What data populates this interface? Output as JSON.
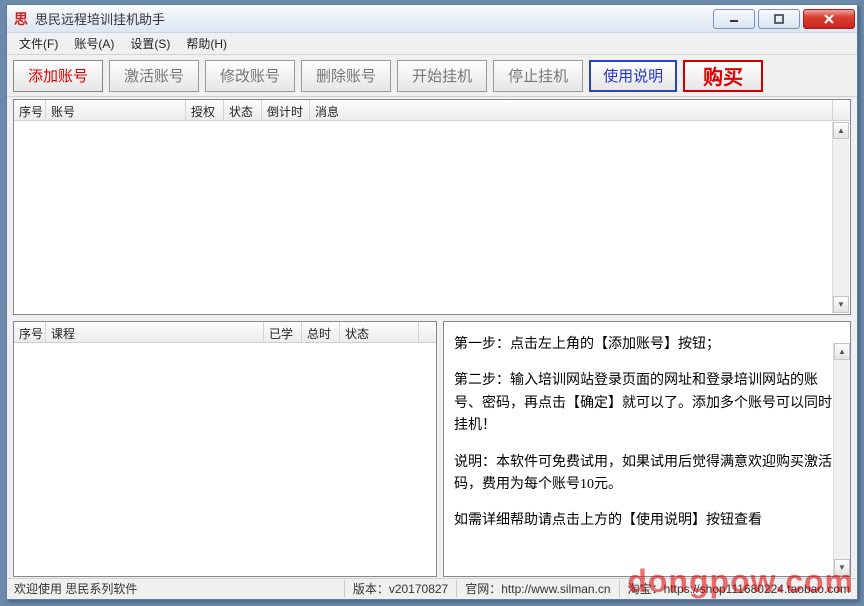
{
  "titlebar": {
    "icon": "思",
    "title": "思民远程培训挂机助手"
  },
  "menu": {
    "file": "文件(F)",
    "account": "账号(A)",
    "settings": "设置(S)",
    "help": "帮助(H)"
  },
  "toolbar": {
    "add": "添加账号",
    "activate": "激活账号",
    "modify": "修改账号",
    "delete": "删除账号",
    "start": "开始挂机",
    "stop": "停止挂机",
    "instructions": "使用说明",
    "buy": "购买"
  },
  "top_cols": {
    "seq": "序号",
    "account": "账号",
    "auth": "授权",
    "status": "状态",
    "countdown": "倒计时",
    "message": "消息"
  },
  "bot_cols": {
    "seq": "序号",
    "course": "课程",
    "learned": "已学",
    "total": "总时",
    "status": "状态"
  },
  "help": {
    "p1": "第一步：点击左上角的【添加账号】按钮；",
    "p2": "第二步：输入培训网站登录页面的网址和登录培训网站的账号、密码，再点击【确定】就可以了。添加多个账号可以同时挂机！",
    "p3": "说明：本软件可免费试用，如果试用后觉得满意欢迎购买激活码，费用为每个账号10元。",
    "p4": "如需详细帮助请点击上方的【使用说明】按钮查看"
  },
  "status": {
    "welcome": "欢迎使用 思民系列软件",
    "version_label": "版本：",
    "version": "v20170827",
    "site_label": "官网：",
    "site": "http://www.silman.cn",
    "shop_label": "淘宝：",
    "shop": "https://shop111680224.taobao.com"
  },
  "watermark": "dongpow.com"
}
